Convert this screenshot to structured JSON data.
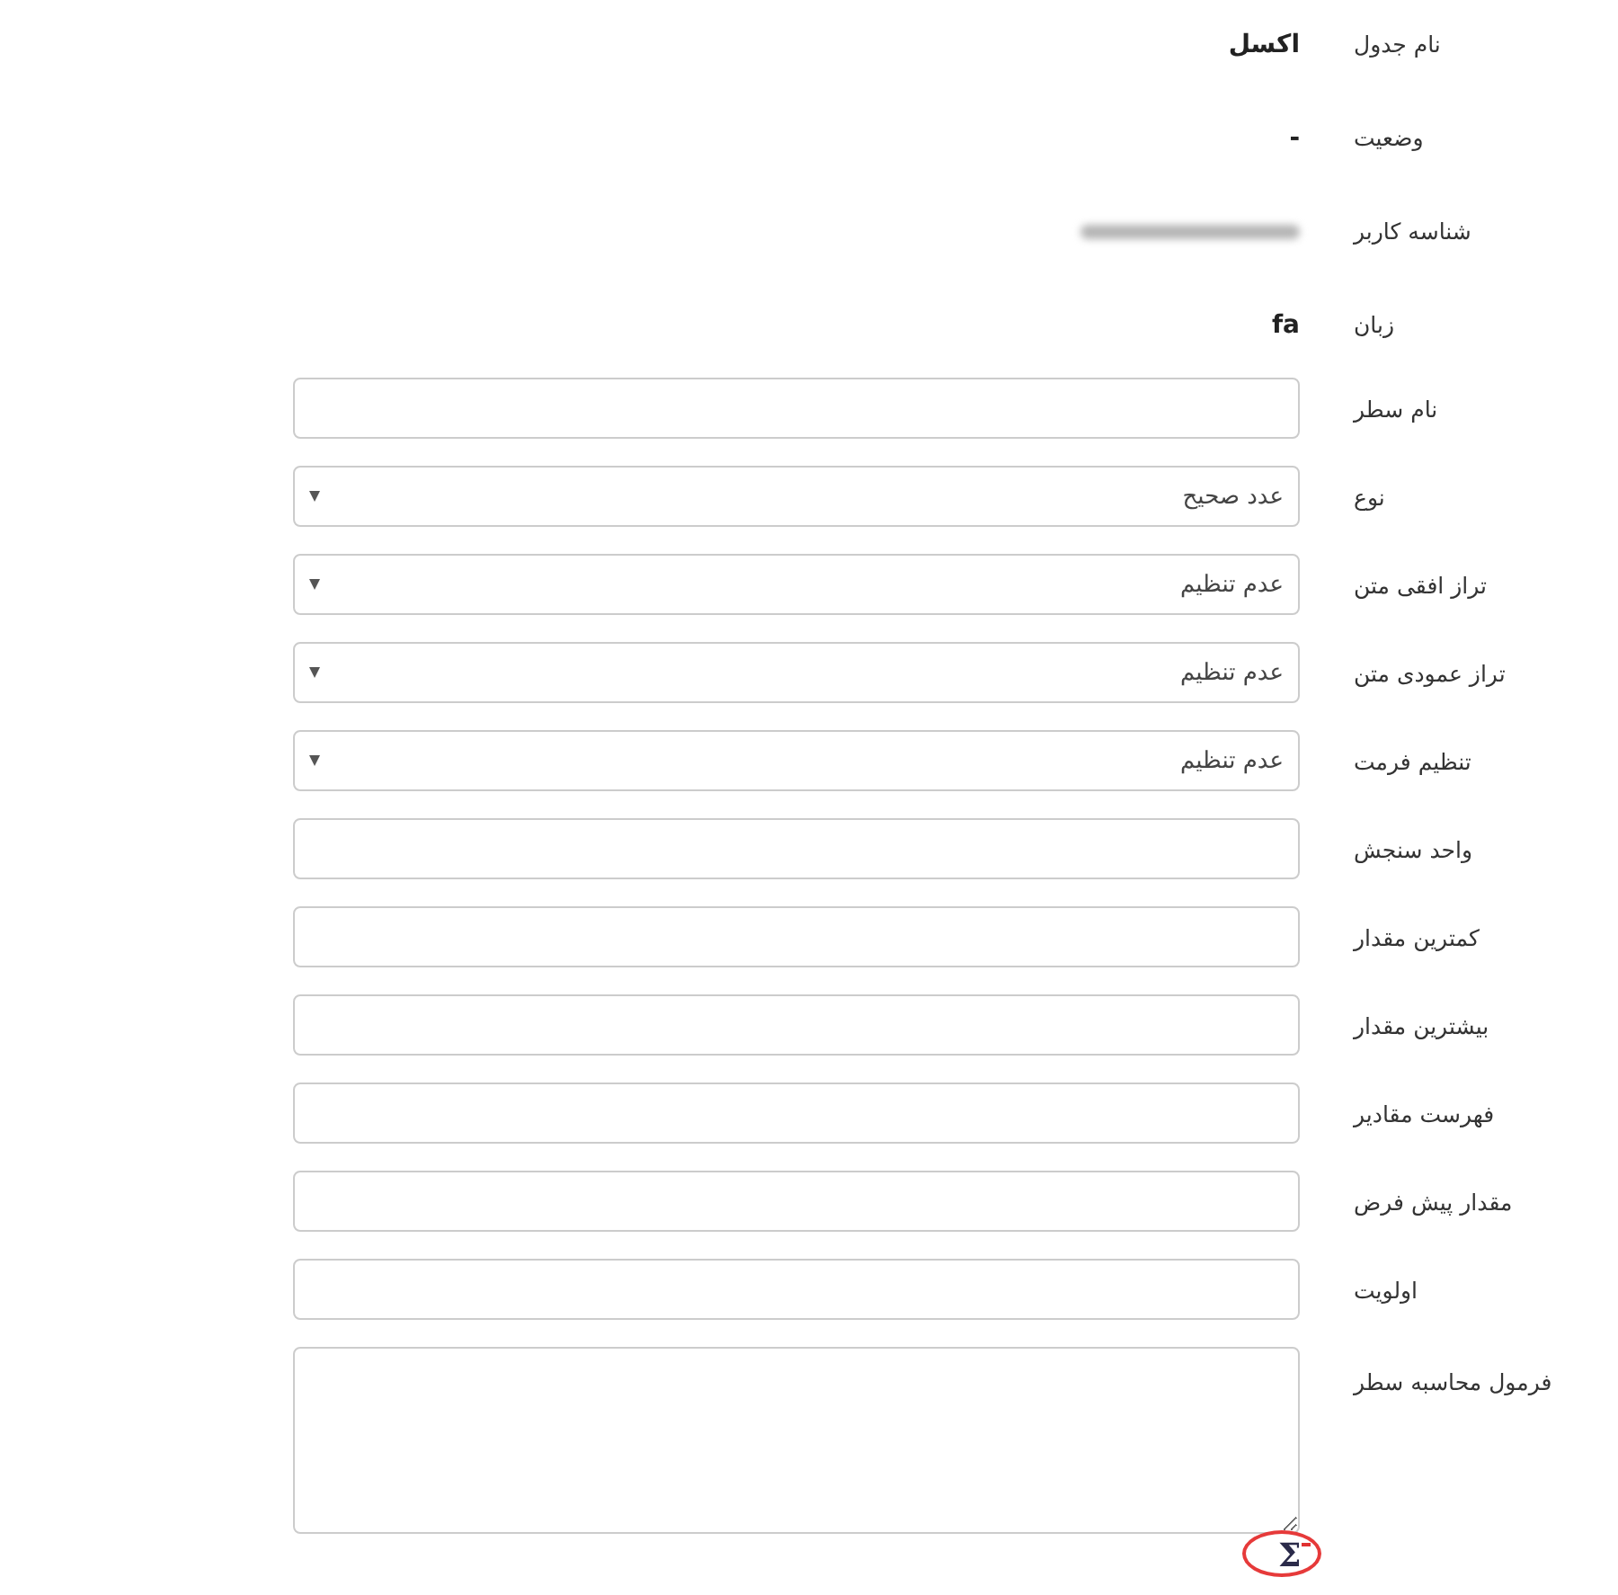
{
  "info": [
    {
      "label": "نام جدول",
      "value": "اکسل",
      "redacted": false
    },
    {
      "label": "وضعیت",
      "value": "-",
      "redacted": false
    },
    {
      "label": "شناسه کاربر",
      "redacted": true
    },
    {
      "label": "زبان",
      "value": "fa",
      "redacted": false
    }
  ],
  "fields": [
    {
      "label": "نام سطر",
      "kind": "text"
    },
    {
      "label": "نوع",
      "kind": "select",
      "value": "عدد صحیح"
    },
    {
      "label": "تراز افقی متن",
      "kind": "select",
      "value": "عدم تنظیم"
    },
    {
      "label": "تراز عمودی متن",
      "kind": "select",
      "value": "عدم تنظیم"
    },
    {
      "label": "تنظیم فرمت",
      "kind": "select",
      "value": "عدم تنظیم"
    },
    {
      "label": "واحد سنجش",
      "kind": "text"
    },
    {
      "label": "کمترین مقدار",
      "kind": "text"
    },
    {
      "label": "بیشترین مقدار",
      "kind": "text"
    },
    {
      "label": "فهرست مقادیر",
      "kind": "text"
    },
    {
      "label": "مقدار پیش فرض",
      "kind": "text"
    },
    {
      "label": "اولویت",
      "kind": "text"
    },
    {
      "label": "فرمول محاسبه سطر",
      "kind": "textarea"
    }
  ],
  "formula_button": {
    "text": "Σ",
    "highlighted": true
  }
}
